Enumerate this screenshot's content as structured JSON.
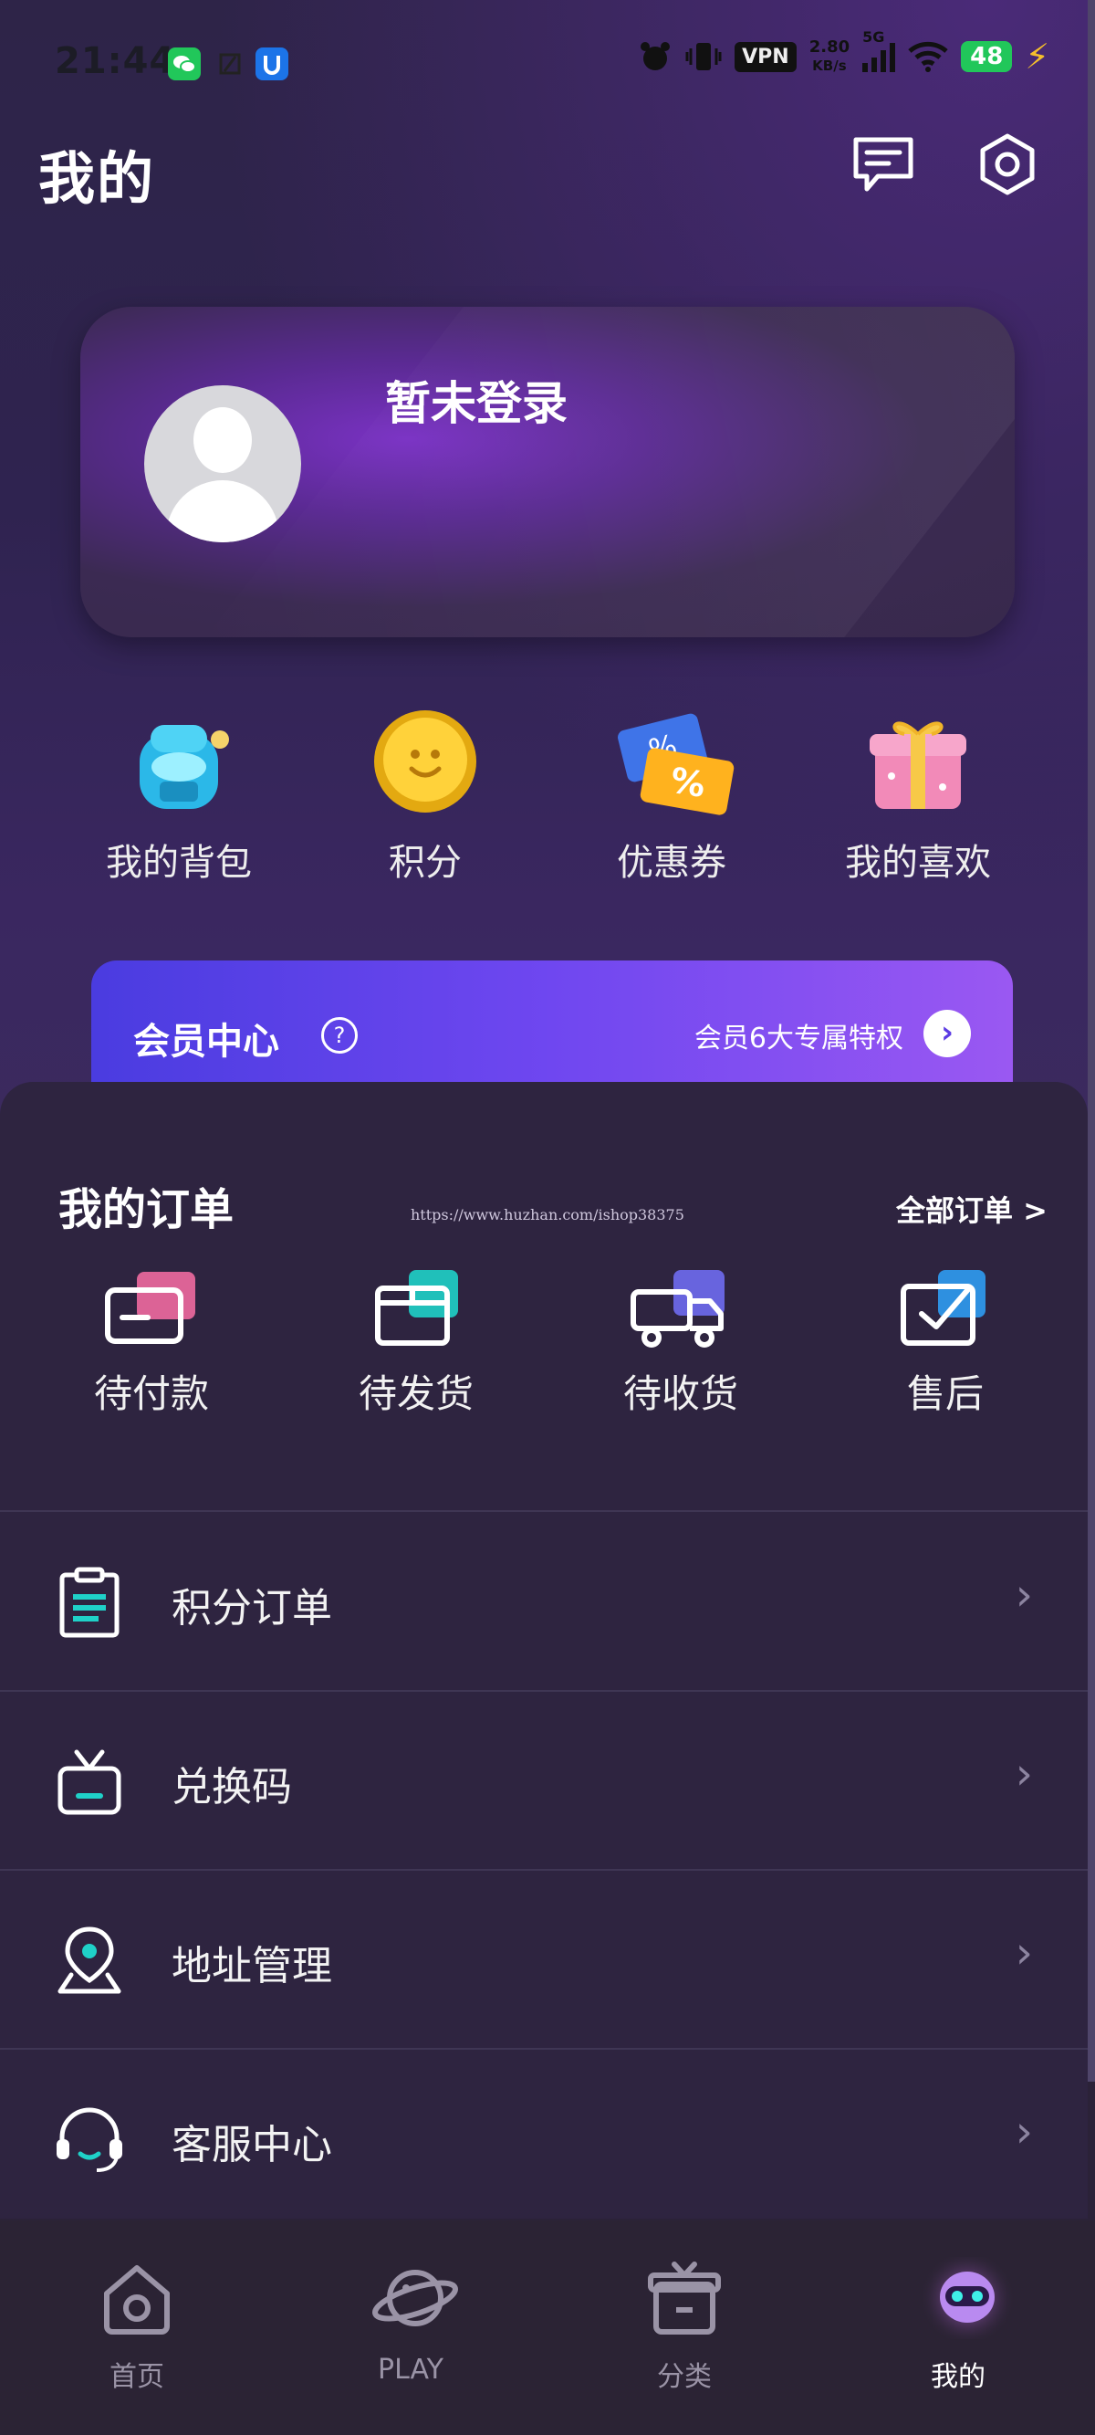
{
  "status_bar": {
    "time": "21:44",
    "vpn": "VPN",
    "net_speed": "2.80",
    "net_unit": "KB/s",
    "network": "5G",
    "battery": "48"
  },
  "header": {
    "title": "我的"
  },
  "profile": {
    "login_text": "暂未登录"
  },
  "quick_links": [
    {
      "label": "我的背包",
      "icon": "backpack-icon"
    },
    {
      "label": "积分",
      "icon": "coin-icon"
    },
    {
      "label": "优惠券",
      "icon": "coupon-icon"
    },
    {
      "label": "我的喜欢",
      "icon": "gift-box-icon"
    }
  ],
  "member": {
    "title": "会员中心",
    "privileges": "会员6大专属特权"
  },
  "orders": {
    "title": "我的订单",
    "all_link": "全部订单 >",
    "watermark": "https://www.huzhan.com/ishop38375",
    "items": [
      {
        "label": "待付款",
        "icon": "payment-card-icon"
      },
      {
        "label": "待发货",
        "icon": "package-icon"
      },
      {
        "label": "待收货",
        "icon": "delivery-truck-icon"
      },
      {
        "label": "售后",
        "icon": "after-sales-icon"
      }
    ]
  },
  "menu": [
    {
      "label": "积分订单",
      "icon": "clipboard-icon"
    },
    {
      "label": "兑换码",
      "icon": "redeem-gift-icon"
    },
    {
      "label": "地址管理",
      "icon": "location-pin-icon"
    },
    {
      "label": "客服中心",
      "icon": "headset-icon"
    }
  ],
  "tabbar": [
    {
      "label": "首页",
      "icon": "home-icon"
    },
    {
      "label": "PLAY",
      "icon": "planet-icon"
    },
    {
      "label": "分类",
      "icon": "category-box-icon"
    },
    {
      "label": "我的",
      "icon": "robot-avatar-icon",
      "active": true
    }
  ],
  "colors": {
    "accent": "#6f47f0",
    "teal": "#1fd1c8",
    "background": "#2e2440"
  }
}
